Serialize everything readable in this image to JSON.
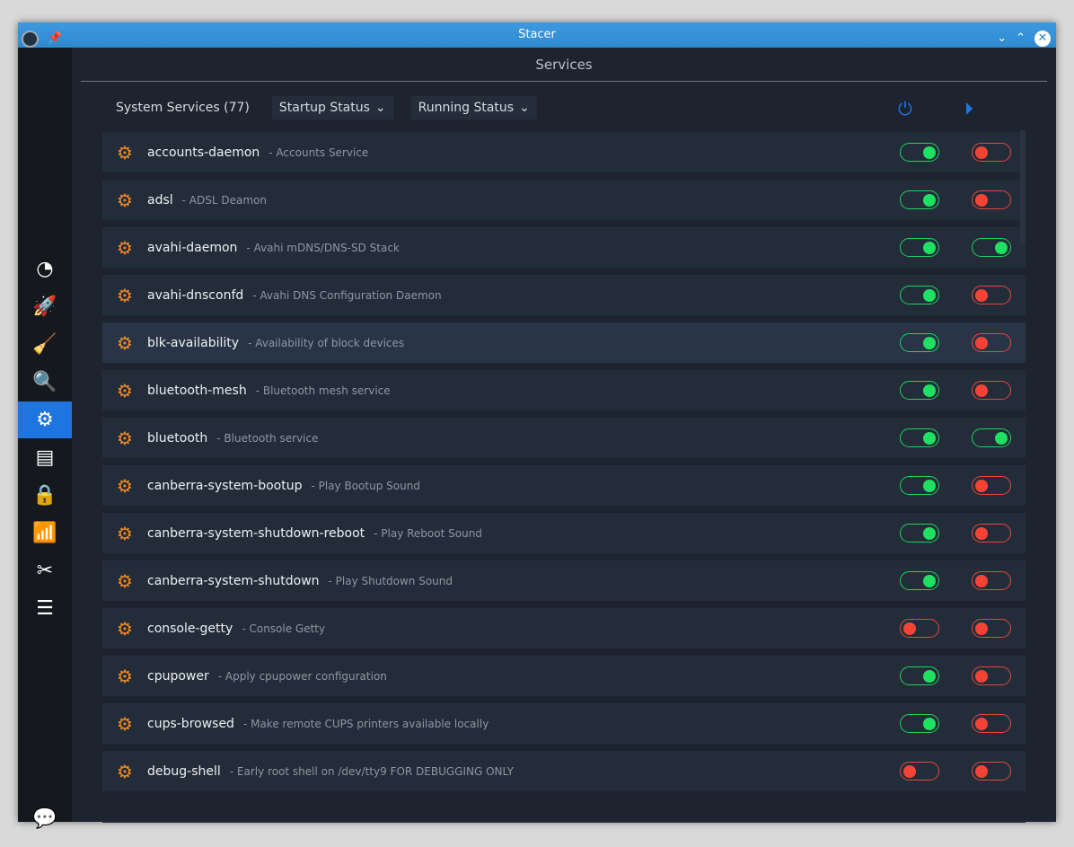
{
  "window": {
    "title": "Stacer"
  },
  "page": {
    "title": "Services"
  },
  "header": {
    "count_label": "System Services (77)",
    "startup_dropdown": "Startup Status",
    "running_dropdown": "Running Status"
  },
  "services": [
    {
      "name": "accounts-daemon",
      "desc": "- Accounts Service",
      "startup": true,
      "running": false
    },
    {
      "name": "adsl",
      "desc": "- ADSL Deamon",
      "startup": true,
      "running": false
    },
    {
      "name": "avahi-daemon",
      "desc": "- Avahi mDNS/DNS-SD Stack",
      "startup": true,
      "running": true
    },
    {
      "name": "avahi-dnsconfd",
      "desc": "- Avahi DNS Configuration Daemon",
      "startup": true,
      "running": false
    },
    {
      "name": "blk-availability",
      "desc": "- Availability of block devices",
      "startup": true,
      "running": false
    },
    {
      "name": "bluetooth-mesh",
      "desc": "- Bluetooth mesh service",
      "startup": true,
      "running": false
    },
    {
      "name": "bluetooth",
      "desc": "- Bluetooth service",
      "startup": true,
      "running": true
    },
    {
      "name": "canberra-system-bootup",
      "desc": "- Play Bootup Sound",
      "startup": true,
      "running": false
    },
    {
      "name": "canberra-system-shutdown-reboot",
      "desc": "- Play Reboot Sound",
      "startup": true,
      "running": false
    },
    {
      "name": "canberra-system-shutdown",
      "desc": "- Play Shutdown Sound",
      "startup": true,
      "running": false
    },
    {
      "name": "console-getty",
      "desc": "- Console Getty",
      "startup": false,
      "running": false
    },
    {
      "name": "cpupower",
      "desc": "- Apply cpupower configuration",
      "startup": true,
      "running": false
    },
    {
      "name": "cups-browsed",
      "desc": "- Make remote CUPS printers available locally",
      "startup": true,
      "running": false
    },
    {
      "name": "debug-shell",
      "desc": "- Early root shell on /dev/tty9 FOR DEBUGGING ONLY",
      "startup": false,
      "running": false
    }
  ],
  "colors": {
    "accent": "#1e74e0",
    "on": "#1fe060",
    "off": "#f44336",
    "gear": "#f08a24"
  }
}
